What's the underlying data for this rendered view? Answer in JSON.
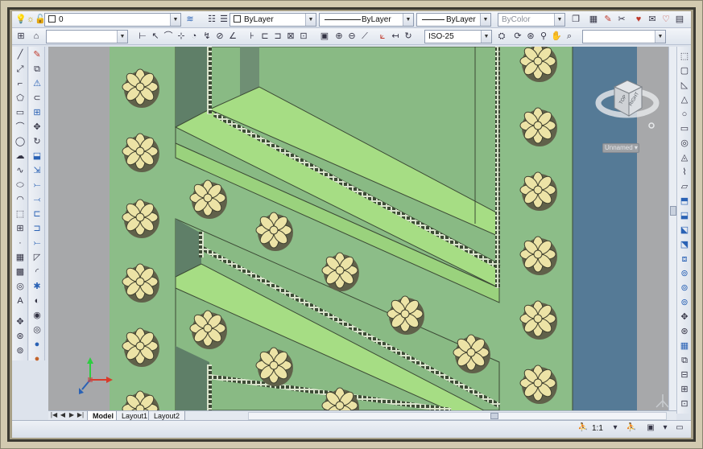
{
  "toolbar1": {
    "layer_name": "0",
    "color": "ByLayer",
    "linetype": "ByLayer",
    "lineweight": "ByLayer",
    "plotstyle": "ByColor"
  },
  "toolbar2": {
    "dimstyle": "ISO-25",
    "viewport_select": "",
    "blank_combo": ""
  },
  "viewcube": {
    "face_top": "TOP",
    "face_right": "RIGHT",
    "ucs_label": "Unnamed"
  },
  "tabs": {
    "model": "Model",
    "layout1": "Layout1",
    "layout2": "Layout2"
  },
  "status": {
    "annotation_scale": "1:1"
  },
  "colors": {
    "floor": "#8cbd88",
    "rail": "#a6dd84",
    "water": "#557a96",
    "flower_petal": "#ece3a6"
  }
}
